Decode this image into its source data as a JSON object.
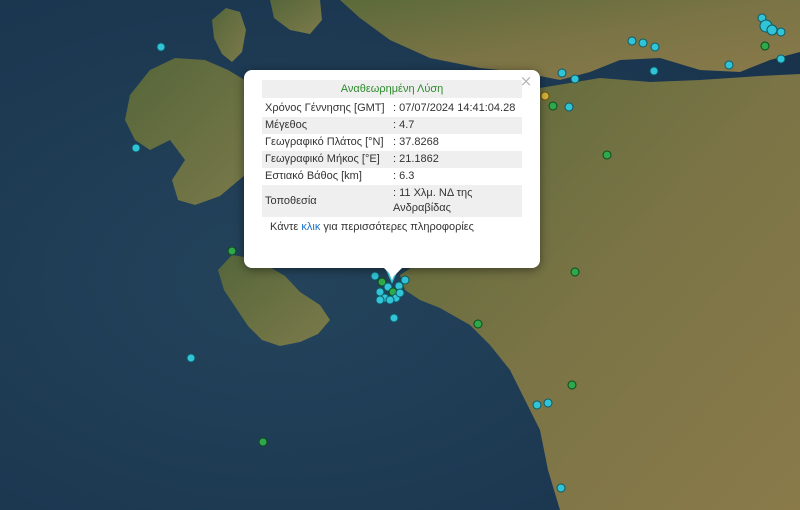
{
  "popup": {
    "title": "Αναθεωρημένη Λύση",
    "rows": [
      {
        "label": "Χρόνος Γέννησης [GMT]",
        "value": ": 07/07/2024 14:41:04.28"
      },
      {
        "label": "Μέγεθος",
        "value": ": 4.7"
      },
      {
        "label": "Γεωγραφικό Πλάτος [°N]",
        "value": ": 37.8268"
      },
      {
        "label": "Γεωγραφικό Μήκος [°E]",
        "value": ": 21.1862"
      },
      {
        "label": "Εστιακό Βάθος [km]",
        "value": ": 6.3"
      },
      {
        "label": "Τοποθεσία",
        "value": ": 11 Χλμ. ΝΔ της Ανδραβίδας"
      }
    ],
    "more_prefix": "Κάντε ",
    "more_link": "κλικ",
    "more_suffix": " για περισσότερες πληροφορίες",
    "close_symbol": "×"
  },
  "colors": {
    "sea": "#1f3a4f",
    "land": "#6b6a3e",
    "marker_cyan": "#31c4d6",
    "marker_green": "#2ea84a",
    "marker_yellow": "#d8b53a",
    "selected_marker": "#ffffff"
  },
  "markers": {
    "icons": [
      "cyan-earthquake-marker",
      "green-earthquake-marker",
      "yellow-earthquake-marker",
      "selected-earthquake-pin"
    ]
  }
}
